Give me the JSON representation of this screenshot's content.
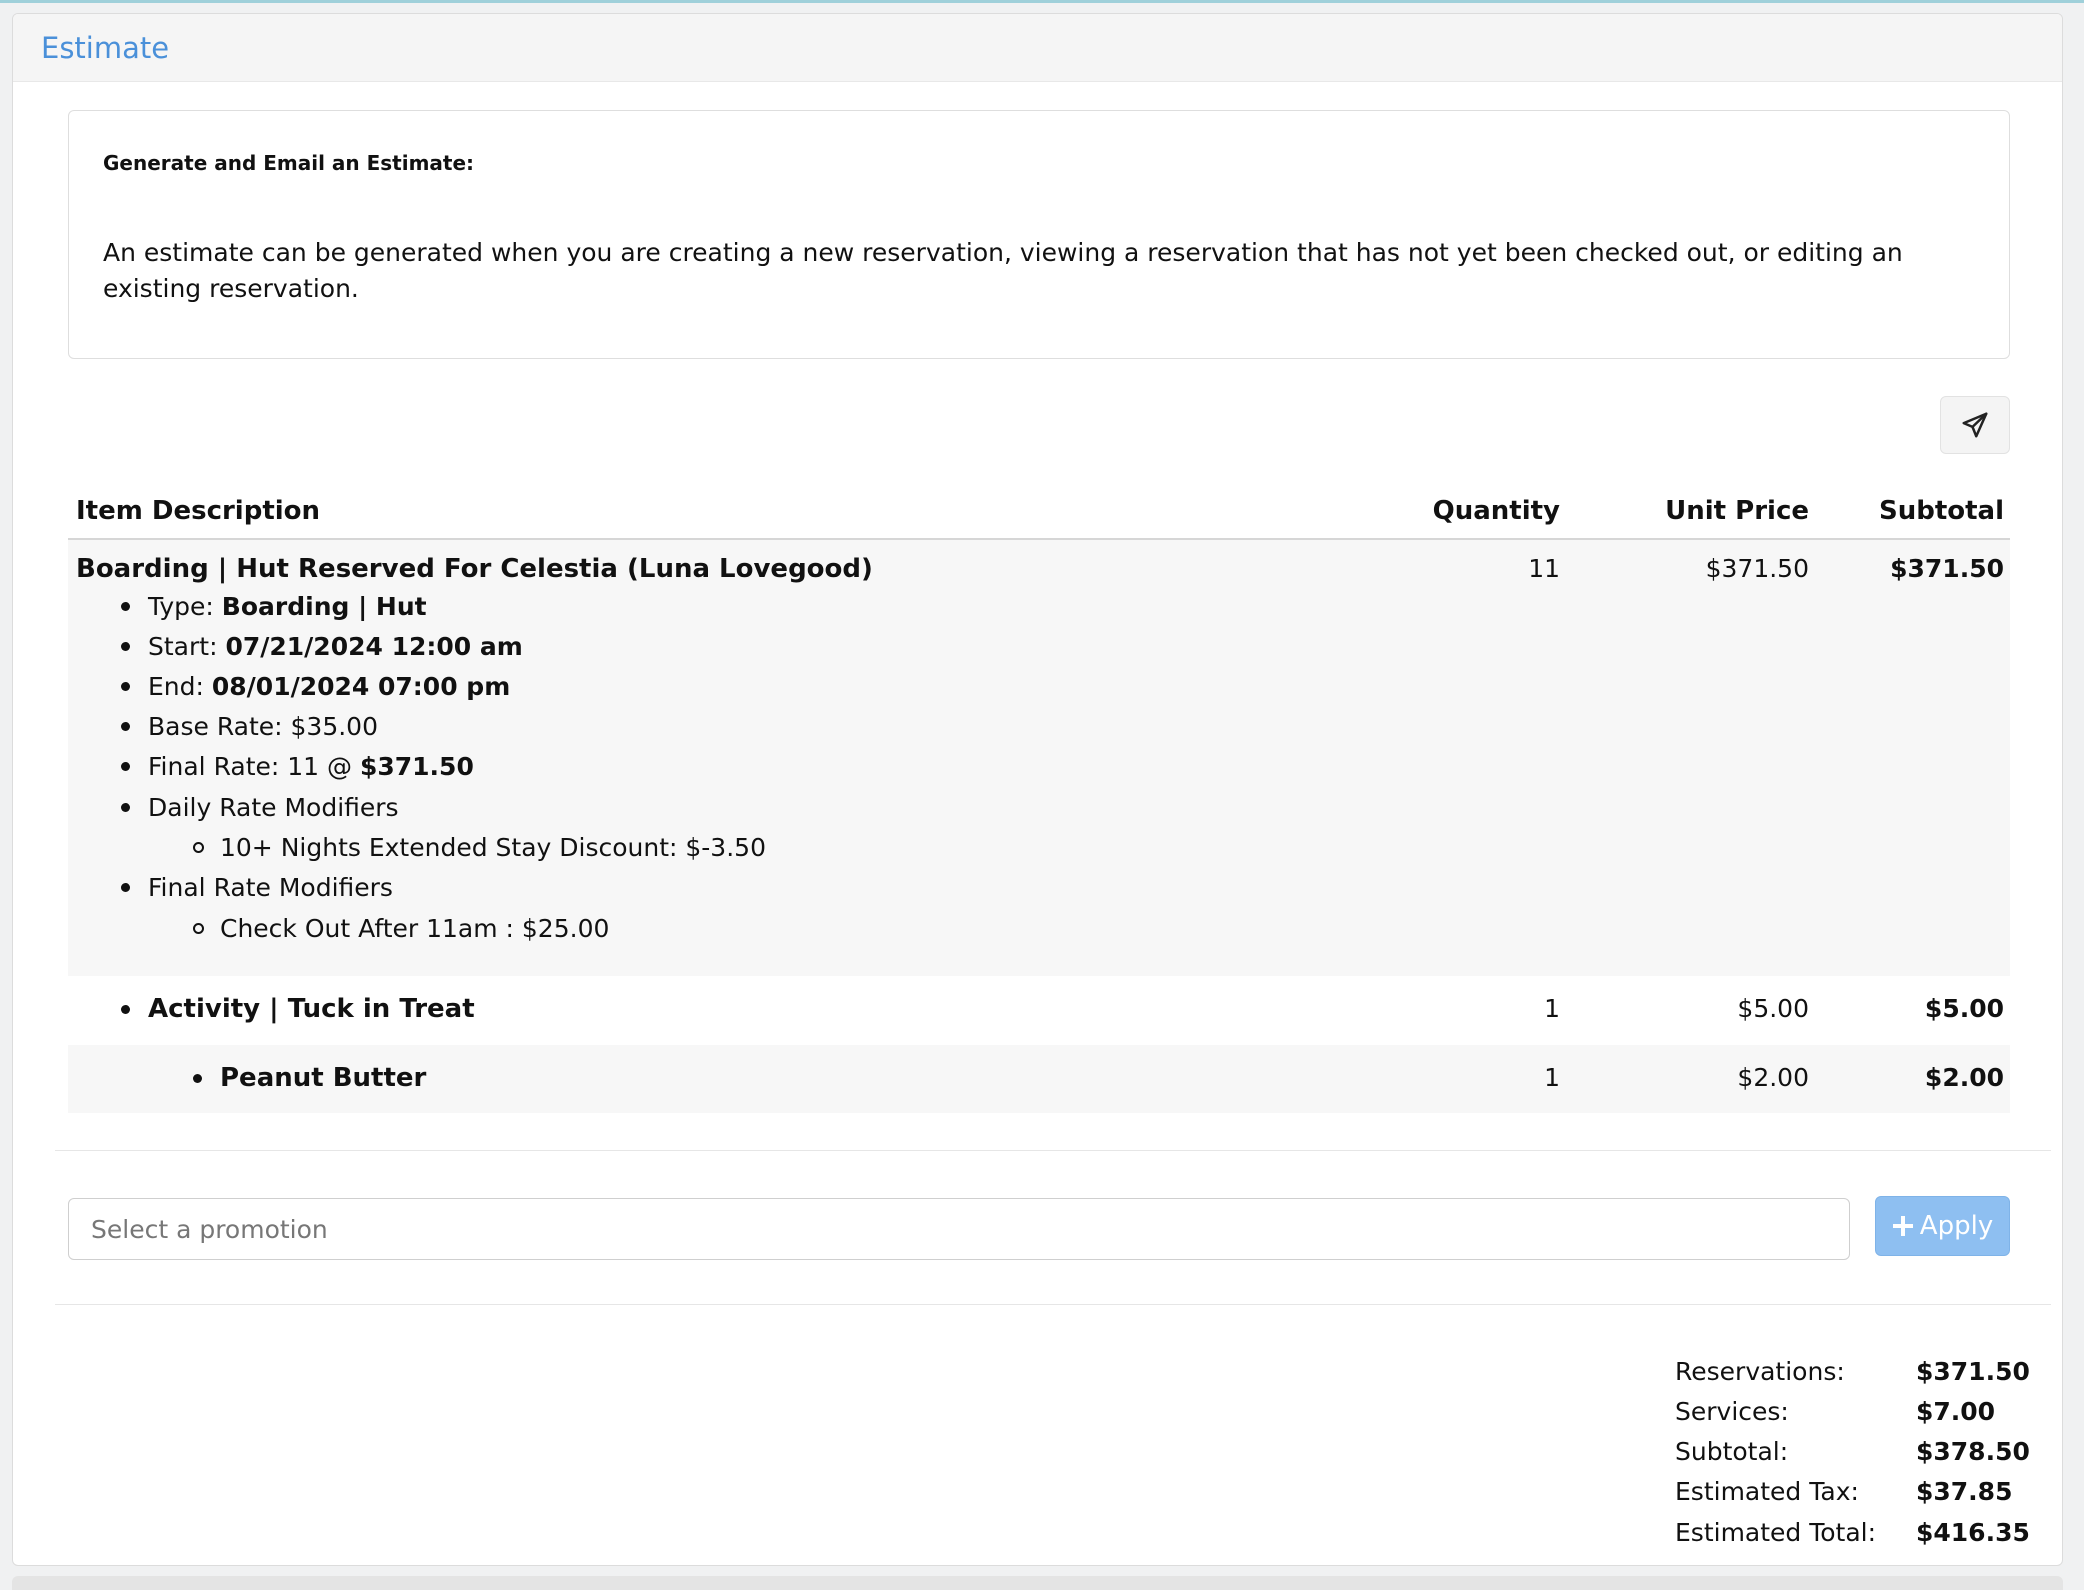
{
  "panel": {
    "title": "Estimate"
  },
  "info": {
    "heading": "Generate and Email an Estimate:",
    "text": "An estimate can be generated when you are creating a new reservation, viewing a reservation that has not yet been checked out, or editing an existing reservation."
  },
  "send_icon": "paper-plane-icon",
  "table": {
    "headers": {
      "description": "Item Description",
      "quantity": "Quantity",
      "unit_price": "Unit Price",
      "subtotal": "Subtotal"
    },
    "main": {
      "title": "Boarding | Hut Reserved For Celestia (Luna Lovegood)",
      "quantity": "11",
      "unit_price": "$371.50",
      "subtotal": "$371.50",
      "type_label": "Type: ",
      "type_value": "Boarding | Hut",
      "start_label": "Start: ",
      "start_value": "07/21/2024 12:00 am",
      "end_label": "End: ",
      "end_value": "08/01/2024 07:00 pm",
      "base_rate": "Base Rate: $35.00",
      "final_rate_label": "Final Rate: 11 @ ",
      "final_rate_value": "$371.50",
      "daily_modifiers": "Daily Rate Modifiers",
      "daily_modifier_item": "10+ Nights Extended Stay Discount: $-3.50",
      "final_modifiers": "Final Rate Modifiers",
      "final_modifier_item": "Check Out After 11am : $25.00"
    },
    "activity": {
      "title": "Activity | Tuck in Treat",
      "quantity": "1",
      "unit_price": "$5.00",
      "subtotal": "$5.00"
    },
    "addon": {
      "title": "Peanut Butter",
      "quantity": "1",
      "unit_price": "$2.00",
      "subtotal": "$2.00"
    }
  },
  "promotion": {
    "placeholder": "Select a promotion",
    "apply_label": "Apply"
  },
  "totals": {
    "reservations_label": "Reservations:",
    "reservations_value": "$371.50",
    "services_label": "Services:",
    "services_value": "$7.00",
    "subtotal_label": "Subtotal:",
    "subtotal_value": "$378.50",
    "tax_label": "Estimated Tax:",
    "tax_value": "$37.85",
    "total_label": "Estimated Total:",
    "total_value": "$416.35"
  }
}
